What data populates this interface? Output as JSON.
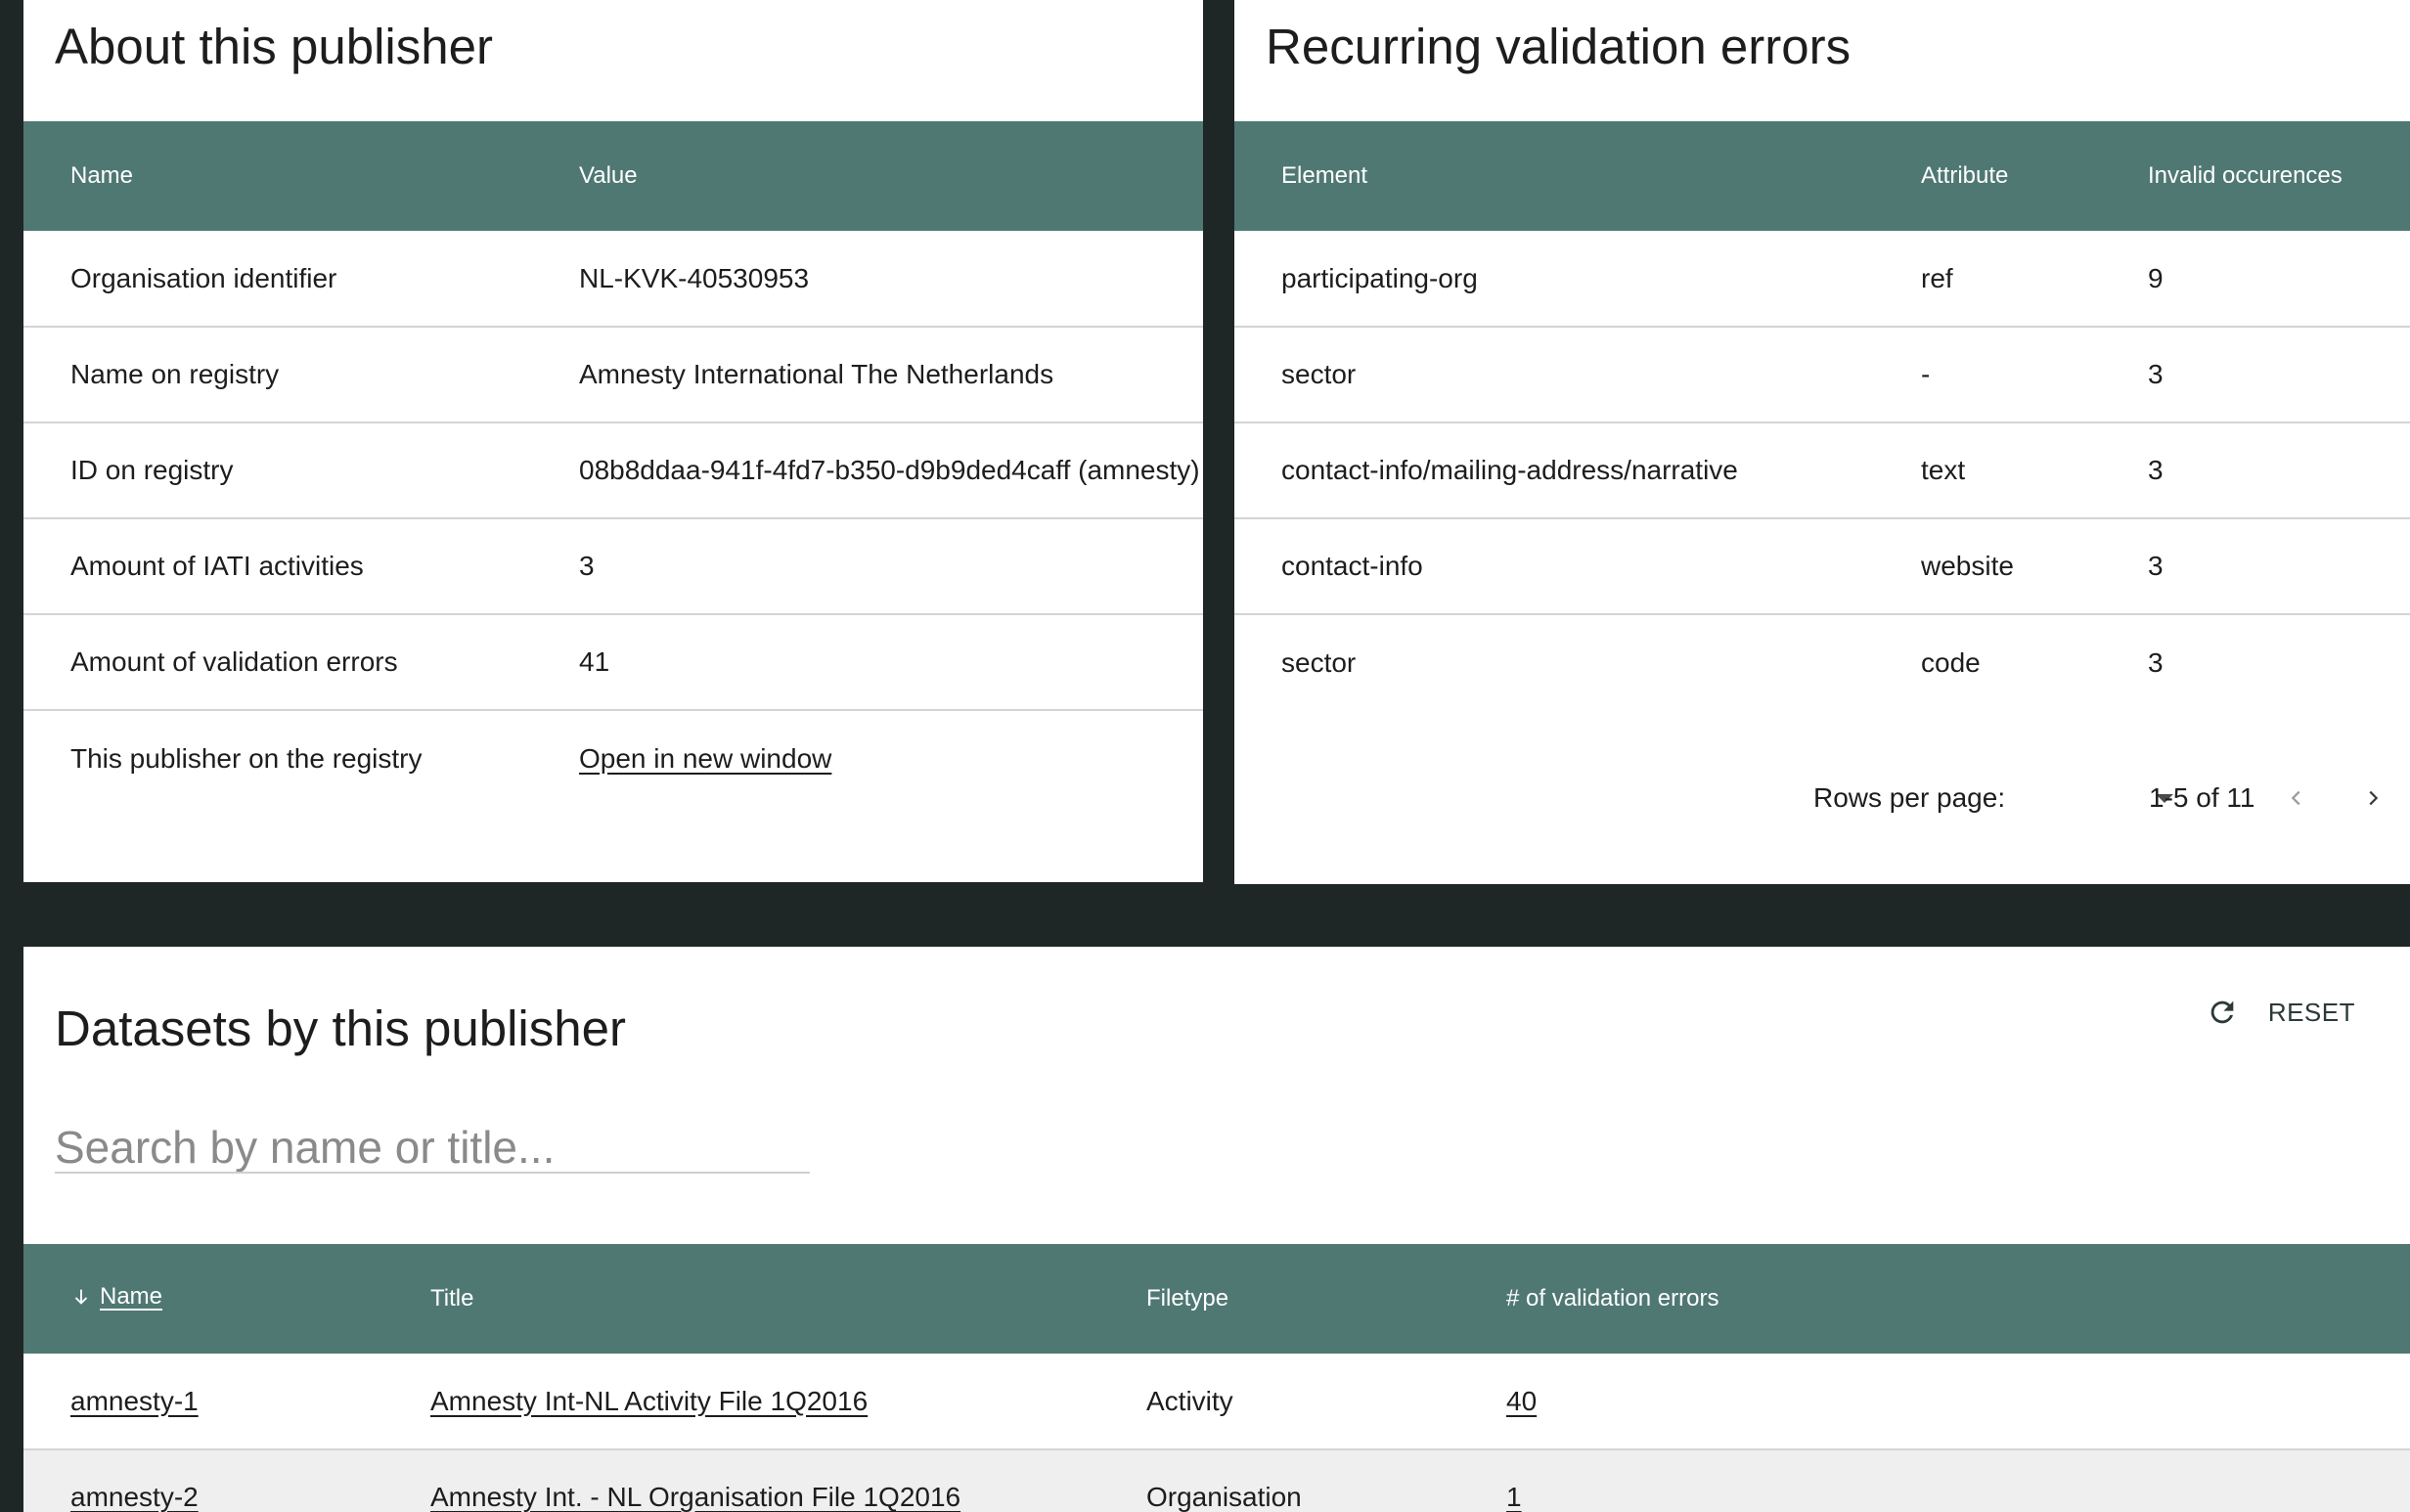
{
  "about": {
    "title": "About this publisher",
    "columns": [
      "Name",
      "Value"
    ],
    "rows": [
      {
        "name": "Organisation identifier",
        "value": "NL-KVK-40530953"
      },
      {
        "name": "Name on registry",
        "value": "Amnesty International The Netherlands"
      },
      {
        "name": "ID on registry",
        "value": "08b8ddaa-941f-4fd7-b350-d9b9ded4caff (amnesty)"
      },
      {
        "name": "Amount of IATI activities",
        "value": "3"
      },
      {
        "name": "Amount of validation errors",
        "value": "41"
      },
      {
        "name": "This publisher on the registry",
        "value": "Open in new window"
      }
    ]
  },
  "errors": {
    "title": "Recurring validation errors",
    "columns": [
      "Element",
      "Attribute",
      "Invalid occurences"
    ],
    "rows": [
      {
        "element": "participating-org",
        "attribute": "ref",
        "count": "9"
      },
      {
        "element": "sector",
        "attribute": "-",
        "count": "3"
      },
      {
        "element": "contact-info/mailing-address/narrative",
        "attribute": "text",
        "count": "3"
      },
      {
        "element": "contact-info",
        "attribute": "website",
        "count": "3"
      },
      {
        "element": "sector",
        "attribute": "code",
        "count": "3"
      }
    ],
    "pagination": {
      "rows_per_page_label": "Rows per page:",
      "range": "1-5 of 11"
    }
  },
  "datasets": {
    "title": "Datasets by this publisher",
    "reset_label": "RESET",
    "search_placeholder": "Search by name or title...",
    "columns": [
      "Name",
      "Title",
      "Filetype",
      "# of validation errors"
    ],
    "rows": [
      {
        "name": "amnesty-1",
        "title": "Amnesty Int-NL Activity File 1Q2016",
        "filetype": "Activity",
        "errors": "40"
      },
      {
        "name": "amnesty-2",
        "title": "Amnesty Int. - NL Organisation File 1Q2016",
        "filetype": "Organisation",
        "errors": "1"
      }
    ]
  },
  "colors": {
    "background": "#1f2626",
    "header_accent": "#4f7873",
    "card": "#ffffff"
  }
}
